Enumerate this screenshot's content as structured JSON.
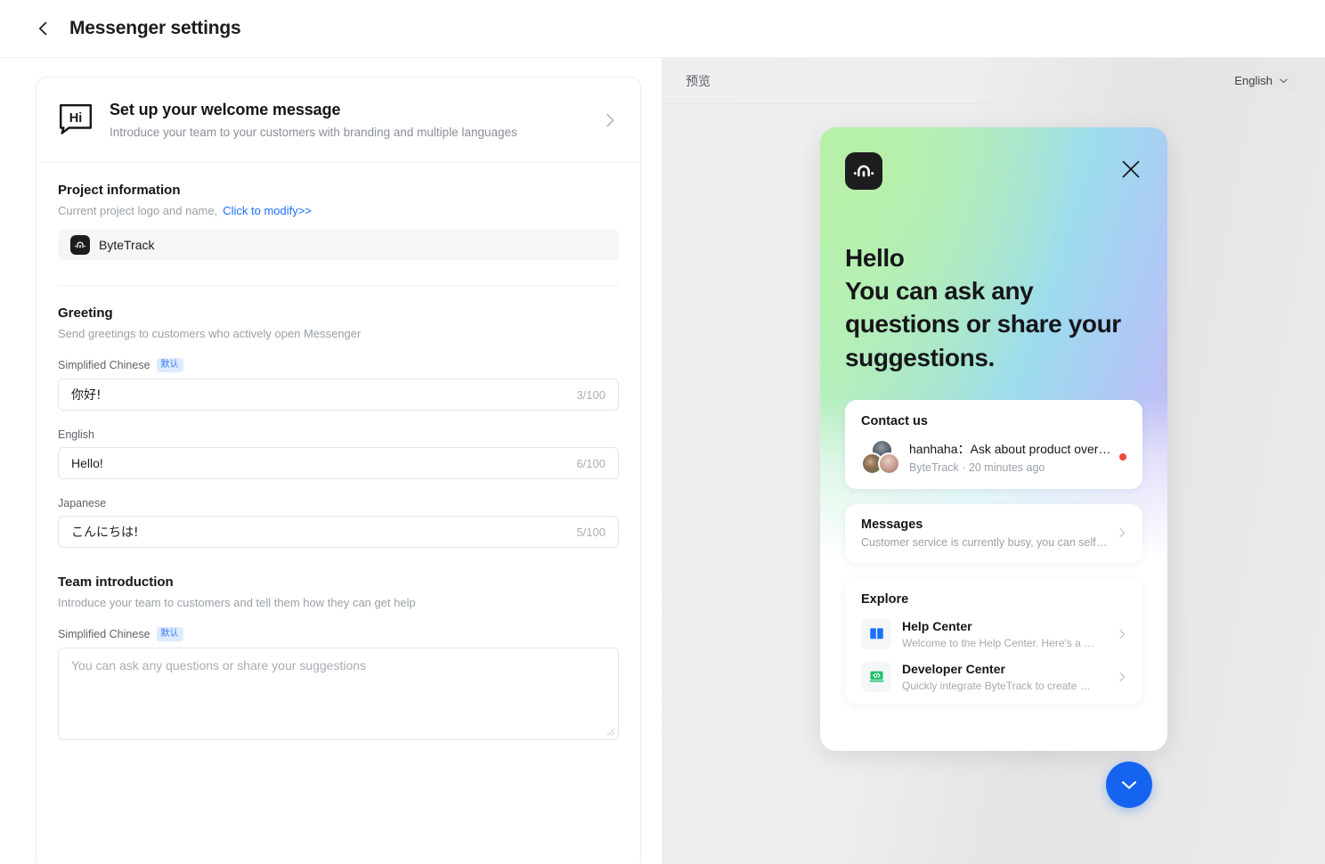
{
  "header": {
    "back_icon": "chevron-left-icon",
    "title": "Messenger settings"
  },
  "welcome_card": {
    "icon": "hi-speech-bubble-icon",
    "title": "Set up your welcome message",
    "subtitle": "Introduce your team to your customers with branding and multiple languages",
    "chevron_icon": "chevron-right-icon"
  },
  "project_information": {
    "title": "Project information",
    "subtitle": "Current project logo and name,",
    "modify_link": "Click to modify>>",
    "logo_icon": "bytetrack-logo-icon",
    "project_name": "ByteTrack"
  },
  "greeting": {
    "title": "Greeting",
    "subtitle": "Send greetings to customers who actively open Messenger",
    "fields": [
      {
        "language": "Simplified Chinese",
        "badge": "默认",
        "value": "你好!",
        "count": "3/100"
      },
      {
        "language": "English",
        "badge": "",
        "value": "Hello!",
        "count": "6/100"
      },
      {
        "language": "Japanese",
        "badge": "",
        "value": "こんにちは!",
        "count": "5/100"
      }
    ]
  },
  "team_introduction": {
    "title": "Team introduction",
    "subtitle": "Introduce your team to customers and tell them how they can get help",
    "language": "Simplified Chinese",
    "badge": "默认",
    "placeholder": "You can ask any questions or share your suggestions",
    "value": ""
  },
  "preview": {
    "label": "预览",
    "language_selected": "English",
    "chevron_icon": "chevron-down-icon"
  },
  "widget": {
    "logo_icon": "bytetrack-logo-icon",
    "close_icon": "close-icon",
    "heading_line1": "Hello",
    "heading_line2": "You can ask any questions or share your suggestions.",
    "contact": {
      "title": "Contact us",
      "avatar_icon": "avatar-group-icon",
      "message": "hanhaha：Ask about product over…",
      "meta": "ByteTrack · 20 minutes ago",
      "unread_badge": "unread-dot"
    },
    "messages": {
      "title": "Messages",
      "subtitle": "Customer service is currently busy, you can self…",
      "chevron_icon": "chevron-right-icon"
    },
    "explore": {
      "title": "Explore",
      "items": [
        {
          "icon": "open-book-icon",
          "title": "Help Center",
          "subtitle": "Welcome to the Help Center. Here's a …",
          "chevron_icon": "chevron-right-icon"
        },
        {
          "icon": "code-laptop-icon",
          "title": "Developer Center",
          "subtitle": "Quickly integrate ByteTrack to create …",
          "chevron_icon": "chevron-right-icon"
        }
      ]
    },
    "fab": {
      "icon": "chevron-down-icon",
      "color": "#1464f0"
    }
  },
  "colors": {
    "link_blue": "#1a6fff",
    "badge_bg": "#dfeaff",
    "badge_text": "#2d7cf6",
    "unread_red": "#f2453d",
    "help_center_blue": "#1a6fff",
    "developer_green": "#1fc16b",
    "fab_blue": "#1464f0"
  }
}
